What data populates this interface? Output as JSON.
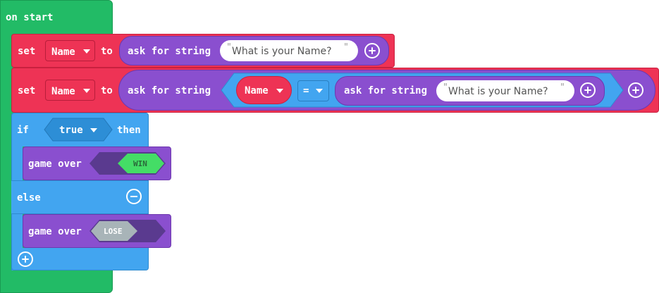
{
  "on_start": {
    "label": "on start"
  },
  "row1": {
    "set_label": "set",
    "variable": "Name",
    "to_label": "to",
    "ask_label": "ask for string",
    "prompt": "What is your Name?"
  },
  "row2": {
    "set_label": "set",
    "variable": "Name",
    "to_label": "to",
    "ask_label": "ask for string",
    "compare_var": "Name",
    "operator": "=",
    "inner_ask_label": "ask for string",
    "prompt": "What is your Name?"
  },
  "if_block": {
    "if_label": "if",
    "condition": "true",
    "then_label": "then",
    "else_label": "else"
  },
  "game_over_win": {
    "label": "game over",
    "value": "WIN"
  },
  "game_over_lose": {
    "label": "game over",
    "value": "LOSE"
  },
  "quote_open": "\"",
  "quote_close": "\"",
  "colors": {
    "events": "#22bb66",
    "variables": "#ee3355",
    "text": "#8a4fcf",
    "logic": "#42a5f0",
    "win_toggle": "#44dd66",
    "lose_toggle": "#a8b4b8"
  },
  "icons": [
    "caret-down-icon",
    "add-icon",
    "remove-icon"
  ]
}
